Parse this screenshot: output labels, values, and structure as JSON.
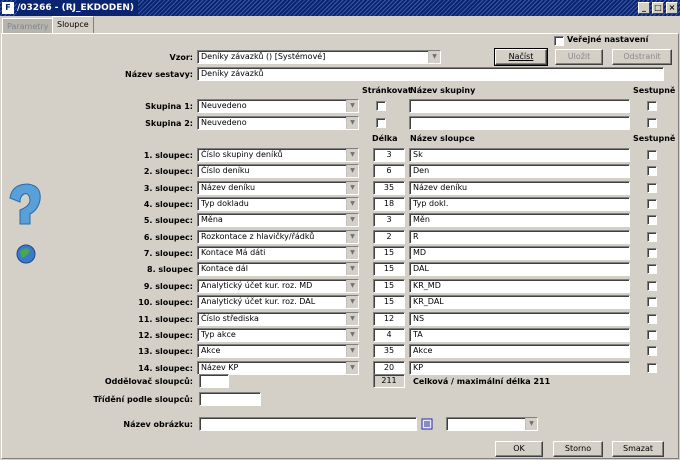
{
  "window": {
    "title": "/03266 - (RJ_EKDODEN)",
    "icon": "app-icon",
    "buttons": [
      "_",
      "□",
      "×"
    ]
  },
  "tabs": [
    {
      "label": "Parametry",
      "active": false
    },
    {
      "label": "Sloupce",
      "active": true
    }
  ],
  "top": {
    "public_label": "Veřejné nastavení",
    "public_checked": false,
    "vzor_label": "Vzor:",
    "vzor_value": "Deníky závazků  ()  [Systémové]",
    "nacist_label": "Načíst",
    "ulozit_label": "Uložit",
    "odstranit_label": "Odstranit",
    "nazev_sestavy_label": "Název sestavy:",
    "nazev_sestavy_value": "Deníky závazků"
  },
  "groups": {
    "header_strankovat": "Stránkovat",
    "header_nazev_skupiny": "Název skupiny",
    "header_sestupne": "Sestupně",
    "rows": [
      {
        "label": "Skupina 1:",
        "value": "Neuvedeno",
        "paging": false,
        "name": "",
        "desc": false
      },
      {
        "label": "Skupina 2:",
        "value": "Neuvedeno",
        "paging": false,
        "name": "",
        "desc": false
      }
    ]
  },
  "columns": {
    "header_delka": "Délka",
    "header_nazev_sloupce": "Název sloupce",
    "header_sestupne": "Sestupně",
    "rows": [
      {
        "label": "1. sloupec:",
        "value": "Číslo skupiny deníků",
        "length": "3",
        "name": "Sk"
      },
      {
        "label": "2. sloupec:",
        "value": "Číslo deníku",
        "length": "6",
        "name": "Den"
      },
      {
        "label": "3. sloupec:",
        "value": "Název deníku",
        "length": "35",
        "name": "Název deníku"
      },
      {
        "label": "4. sloupec:",
        "value": "Typ dokladu",
        "length": "18",
        "name": "Typ dokl."
      },
      {
        "label": "5. sloupec:",
        "value": "Měna",
        "length": "3",
        "name": "Měn"
      },
      {
        "label": "6. sloupec:",
        "value": "Rozkontace z hlavičky/řádků",
        "length": "2",
        "name": "R"
      },
      {
        "label": "7. sloupec:",
        "value": "Kontace Má dáti",
        "length": "15",
        "name": "MD"
      },
      {
        "label": "8. sloupec",
        "value": "Kontace dál",
        "length": "15",
        "name": "DAL"
      },
      {
        "label": "9. sloupec:",
        "value": "Analytický účet kur. roz. MD",
        "length": "15",
        "name": "KR_MD"
      },
      {
        "label": "10. sloupec:",
        "value": "Analytický účet kur. roz. DAL",
        "length": "15",
        "name": "KR_DAL"
      },
      {
        "label": "11. sloupec:",
        "value": "Číslo střediska",
        "length": "12",
        "name": "NS"
      },
      {
        "label": "12. sloupec:",
        "value": "Typ akce",
        "length": "4",
        "name": "TA"
      },
      {
        "label": "13. sloupec:",
        "value": "Akce",
        "length": "35",
        "name": "Akce"
      },
      {
        "label": "14. sloupec:",
        "value": "Název KP",
        "length": "20",
        "name": "KP"
      }
    ]
  },
  "bottom": {
    "oddelovac_label": "Oddělovač sloupců:",
    "oddelovac_value": "",
    "total_value": "211",
    "total_label": "Celková / maximální délka 211",
    "trideni_label": "Třídění podle sloupců:",
    "trideni_value": "",
    "nazev_obrazku_label": "Název obrázku:",
    "nazev_obrazku_value": "",
    "obrazek_select_value": "",
    "ok_label": "OK",
    "storno_label": "Storno",
    "smazat_label": "Smazat"
  },
  "colors": {
    "titlebar": "#0a2470",
    "panel": "#d4d0c8"
  }
}
